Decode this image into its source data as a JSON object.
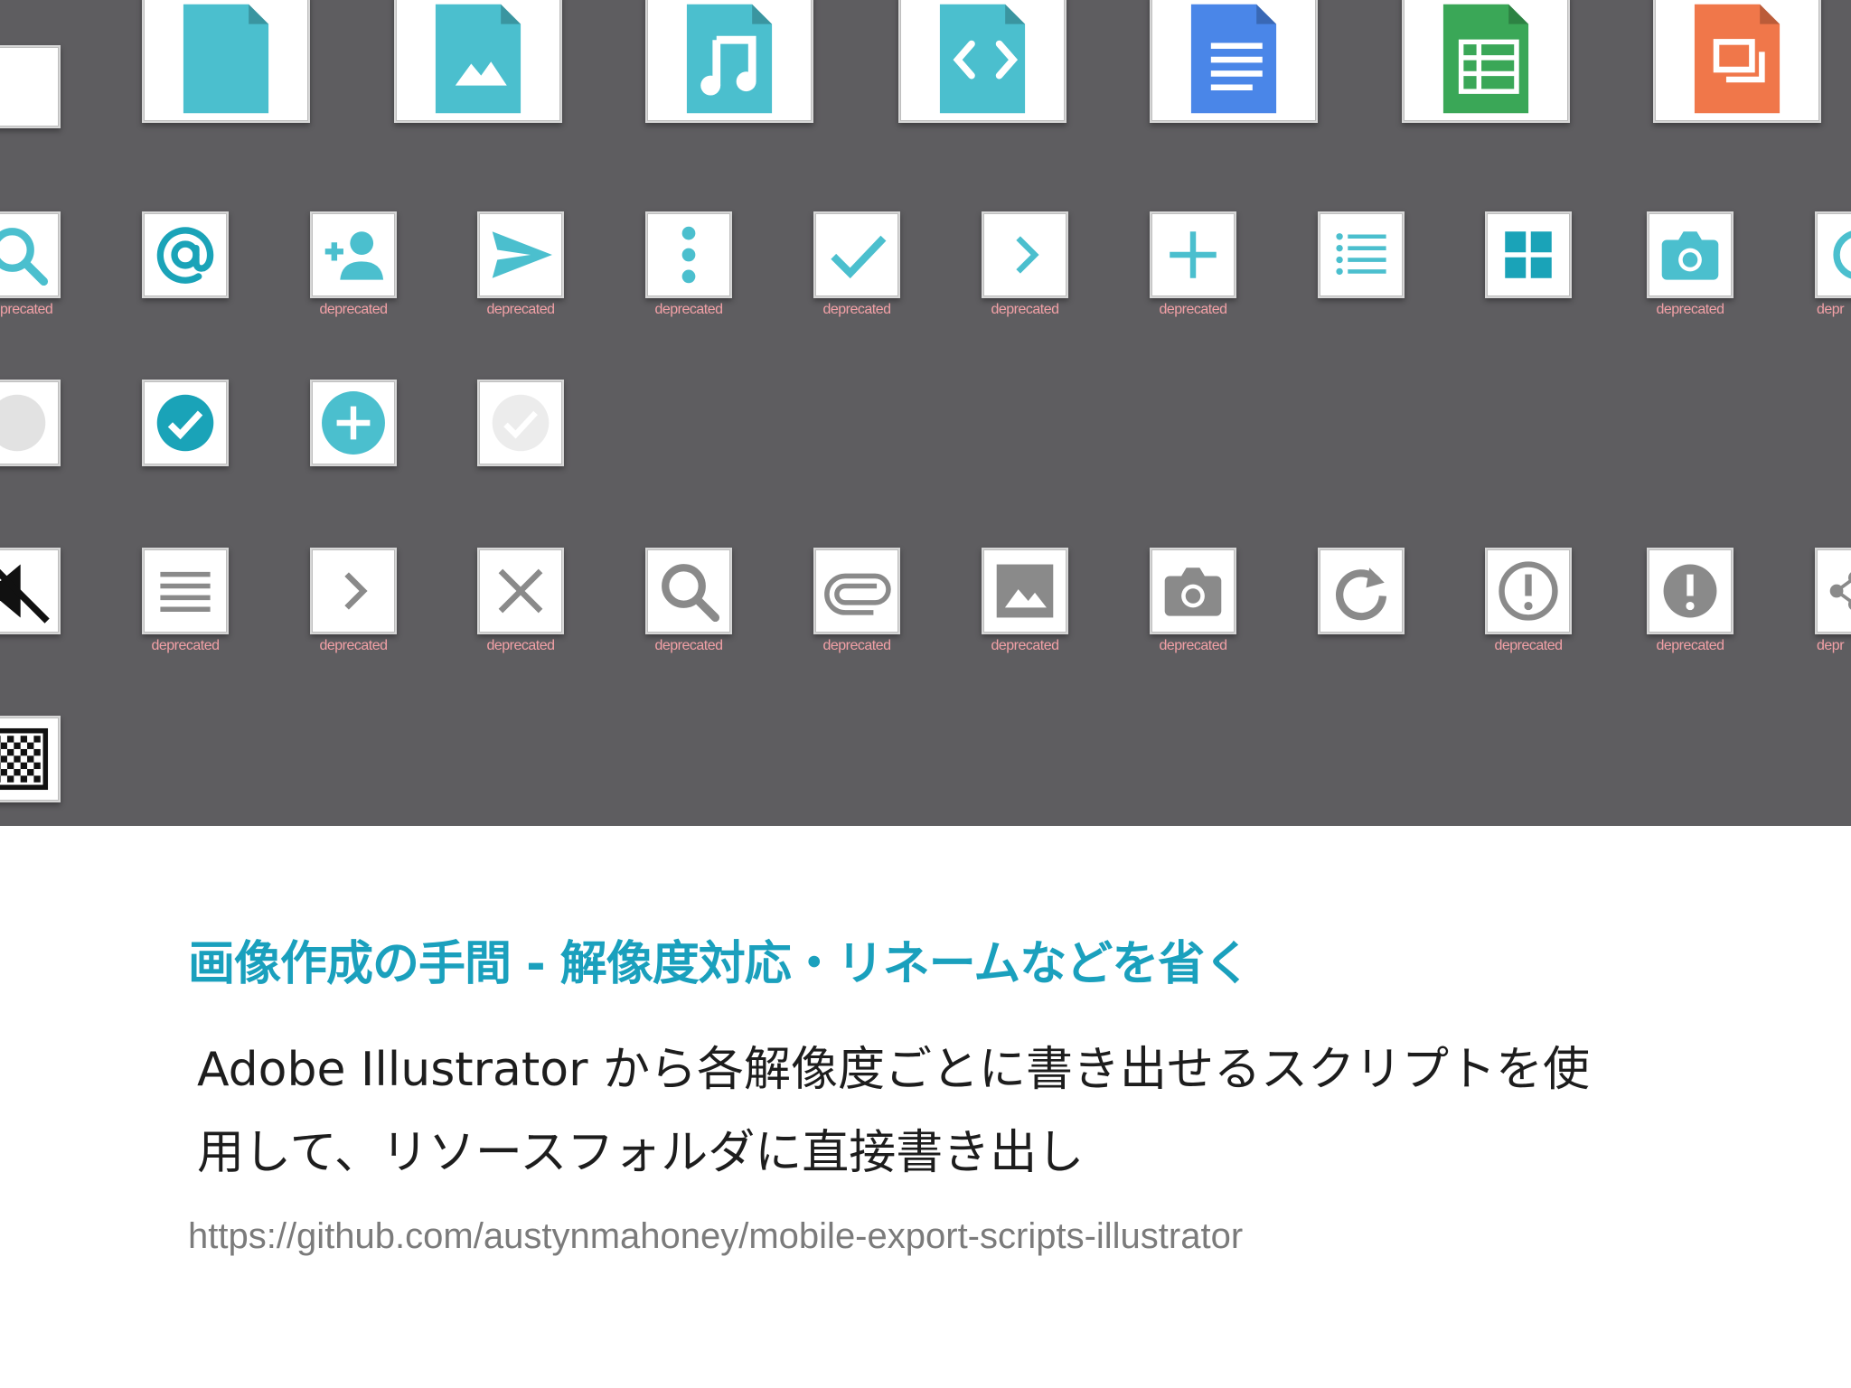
{
  "artboard": {
    "background_color": "#5e5d60",
    "rows": [
      {
        "items": [
          {
            "icon": "blank-tile-icon",
            "label": ""
          },
          {
            "icon": "generic-file-icon",
            "label": ""
          },
          {
            "icon": "image-file-icon",
            "label": ""
          },
          {
            "icon": "audio-file-icon",
            "label": ""
          },
          {
            "icon": "code-file-icon",
            "label": ""
          },
          {
            "icon": "document-file-icon",
            "label": ""
          },
          {
            "icon": "spreadsheet-file-icon",
            "label": ""
          },
          {
            "icon": "presentation-file-icon",
            "label": ""
          }
        ]
      },
      {
        "items": [
          {
            "icon": "search-icon",
            "label": "precated"
          },
          {
            "icon": "at-sign-icon",
            "label": ""
          },
          {
            "icon": "add-person-icon",
            "label": "deprecated"
          },
          {
            "icon": "send-icon",
            "label": "deprecated"
          },
          {
            "icon": "more-vertical-icon",
            "label": "deprecated"
          },
          {
            "icon": "checkmark-icon",
            "label": "deprecated"
          },
          {
            "icon": "chevron-right-icon",
            "label": "deprecated"
          },
          {
            "icon": "plus-icon",
            "label": "deprecated"
          },
          {
            "icon": "list-icon",
            "label": ""
          },
          {
            "icon": "grid-icon",
            "label": ""
          },
          {
            "icon": "camera-icon",
            "label": "deprecated"
          },
          {
            "icon": "refresh-icon",
            "label": "depr"
          }
        ]
      },
      {
        "items": [
          {
            "icon": "gray-circle-icon",
            "label": ""
          },
          {
            "icon": "check-circle-icon",
            "label": ""
          },
          {
            "icon": "add-circle-icon",
            "label": ""
          },
          {
            "icon": "check-circle-disabled-icon",
            "label": ""
          }
        ]
      },
      {
        "items": [
          {
            "icon": "volume-mute-icon",
            "label": ""
          },
          {
            "icon": "menu-icon",
            "label": "deprecated"
          },
          {
            "icon": "chevron-right-icon",
            "label": "deprecated"
          },
          {
            "icon": "close-icon",
            "label": "deprecated"
          },
          {
            "icon": "search-icon",
            "label": "deprecated"
          },
          {
            "icon": "paperclip-icon",
            "label": "deprecated"
          },
          {
            "icon": "image-icon",
            "label": "deprecated"
          },
          {
            "icon": "camera-icon",
            "label": "deprecated"
          },
          {
            "icon": "redo-icon",
            "label": ""
          },
          {
            "icon": "alert-outline-icon",
            "label": "deprecated"
          },
          {
            "icon": "alert-filled-icon",
            "label": "deprecated"
          },
          {
            "icon": "share-icon",
            "label": "depr"
          }
        ]
      },
      {
        "items": [
          {
            "icon": "checkerboard-icon",
            "label": ""
          }
        ]
      }
    ]
  },
  "heading": "画像作成の手間 - 解像度対応・リネームなどを省く",
  "description": {
    "line1": "Adobe Illustrator から各解像度ごとに書き出せるスクリプトを使",
    "line2": "用して、リソースフォルダに直接書き出し"
  },
  "link": "https://github.com/austynmahoney/mobile-export-scripts-illustrator",
  "colors": {
    "teal": "#4bbfce",
    "teal_dark": "#1aa3b8",
    "gray": "#8a8a8a",
    "google_blue": "#4a86e8",
    "google_green": "#3aa757",
    "orange": "#f0774a",
    "label_pink": "#f2a0a6",
    "heading": "#1aa0bd"
  }
}
